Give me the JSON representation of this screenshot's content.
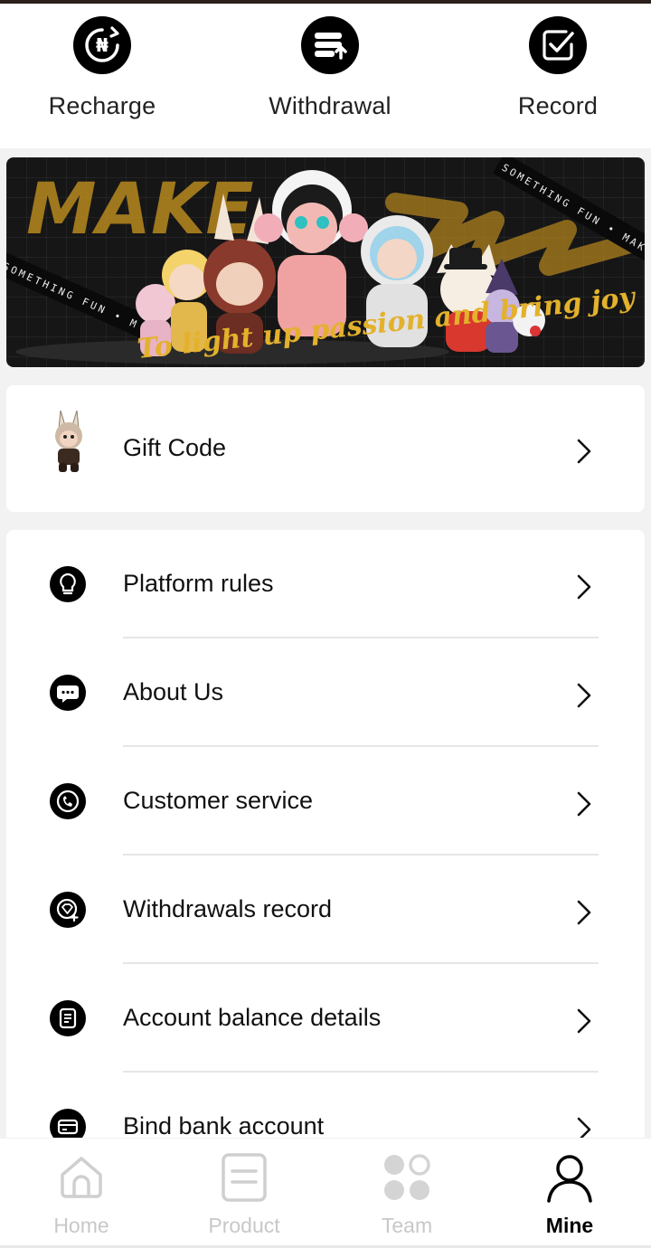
{
  "actions": [
    {
      "label": "Recharge",
      "icon": "naira-refresh-icon"
    },
    {
      "label": "Withdrawal",
      "icon": "withdraw-card-icon"
    },
    {
      "label": "Record",
      "icon": "checkbox-icon"
    }
  ],
  "banner": {
    "headline": "MAKE",
    "headline2": "SOMETHING",
    "ribbon_top": "SOMETHING  FUN • MAKE SO",
    "ribbon_left": "SOMETHING  FUN • M",
    "tagline": "To light up passion and bring joy"
  },
  "gift": {
    "label": "Gift Code",
    "icon": "labubu-toy-icon"
  },
  "menu": [
    {
      "label": "Platform rules",
      "icon": "lightbulb-icon"
    },
    {
      "label": "About Us",
      "icon": "chat-bubble-icon"
    },
    {
      "label": "Customer service",
      "icon": "phone-service-icon"
    },
    {
      "label": "Withdrawals record",
      "icon": "diamond-plus-icon"
    },
    {
      "label": "Account balance details",
      "icon": "document-icon"
    },
    {
      "label": "Bind bank account",
      "icon": "bank-card-icon"
    }
  ],
  "tabs": [
    {
      "label": "Home",
      "icon": "home-icon",
      "active": false
    },
    {
      "label": "Product",
      "icon": "product-list-icon",
      "active": false
    },
    {
      "label": "Team",
      "icon": "team-grid-icon",
      "active": false
    },
    {
      "label": "Mine",
      "icon": "user-icon",
      "active": true
    }
  ],
  "colors": {
    "accent_gold": "#d8a72a",
    "active_tab": "#000000",
    "inactive_tab": "#c8c8c8",
    "icon_bg": "#000000"
  }
}
